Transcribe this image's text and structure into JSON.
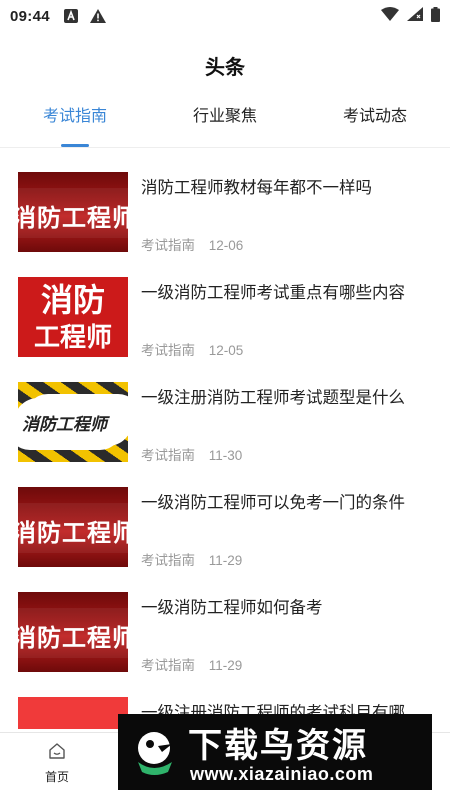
{
  "status_bar": {
    "time": "09:44",
    "icons": [
      "font-a-icon",
      "warning-icon"
    ],
    "right_icons": [
      "wifi-icon",
      "signal-icon",
      "battery-icon"
    ]
  },
  "header": {
    "title": "头条"
  },
  "tabs": [
    {
      "label": "考试指南",
      "active": true
    },
    {
      "label": "行业聚焦",
      "active": false
    },
    {
      "label": "考试动态",
      "active": false
    }
  ],
  "articles": [
    {
      "title": "消防工程师教材每年都不一样吗",
      "category": "考试指南",
      "date": "12-06",
      "thumb_text": "消防工程师"
    },
    {
      "title": "一级消防工程师考试重点有哪些内容",
      "category": "考试指南",
      "date": "12-05",
      "thumb_text_line1": "消防",
      "thumb_text_line2": "工程师"
    },
    {
      "title": "一级注册消防工程师考试题型是什么",
      "category": "考试指南",
      "date": "11-30",
      "thumb_text": "消防工程师"
    },
    {
      "title": "一级消防工程师可以免考一门的条件",
      "category": "考试指南",
      "date": "11-29",
      "thumb_text": "消防工程师"
    },
    {
      "title": "一级消防工程师如何备考",
      "category": "考试指南",
      "date": "11-29",
      "thumb_text": "消防工程师"
    },
    {
      "title": "一级注册消防工程师的考试科目有哪",
      "category": "",
      "date": ""
    }
  ],
  "bottom_nav": {
    "home_label": "首页"
  },
  "watermark": {
    "title": "下载鸟资源",
    "url": "www.xiazainiao.com"
  },
  "colors": {
    "accent": "#3a86d6",
    "meta_text": "#999999",
    "banner_red": "#a71818"
  }
}
